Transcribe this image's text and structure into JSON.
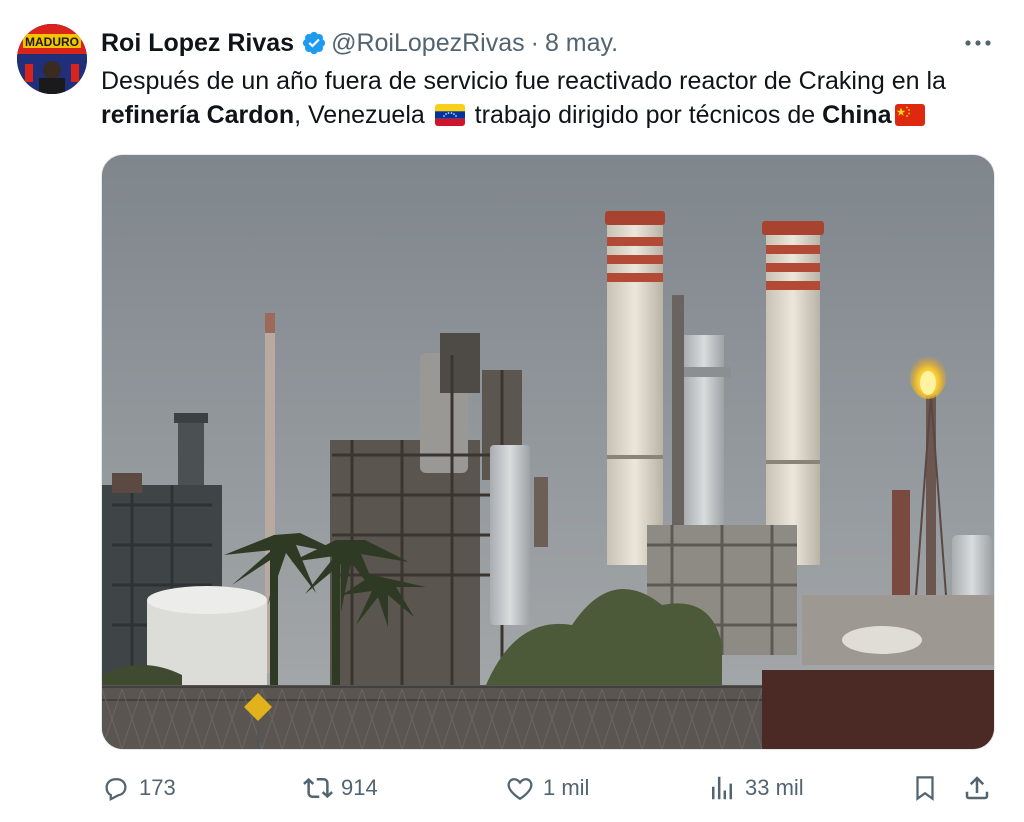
{
  "author": {
    "display_name": "Roi Lopez Rivas",
    "handle": "@RoiLopezRivas",
    "separator": "·",
    "date": "8 may.",
    "verified": true,
    "avatar_text": "MADURO"
  },
  "tweet": {
    "text_part1": "Después de un año fuera de servicio fue reactivado reactor de Craking en la ",
    "bold1": "refinería Cardon",
    "text_part2": ", Venezuela ",
    "flag1": "Venezuela flag",
    "text_part3": " trabajo dirigido por técnicos de ",
    "bold2": "China",
    "flag2": "China flag"
  },
  "media": {
    "description_icon": "refinery-photo"
  },
  "actions": {
    "replies": "173",
    "reposts": "914",
    "likes": "1 mil",
    "views": "33 mil"
  },
  "colors": {
    "text": "#0f1419",
    "secondary": "#536471",
    "verified": "#1d9bf0"
  }
}
